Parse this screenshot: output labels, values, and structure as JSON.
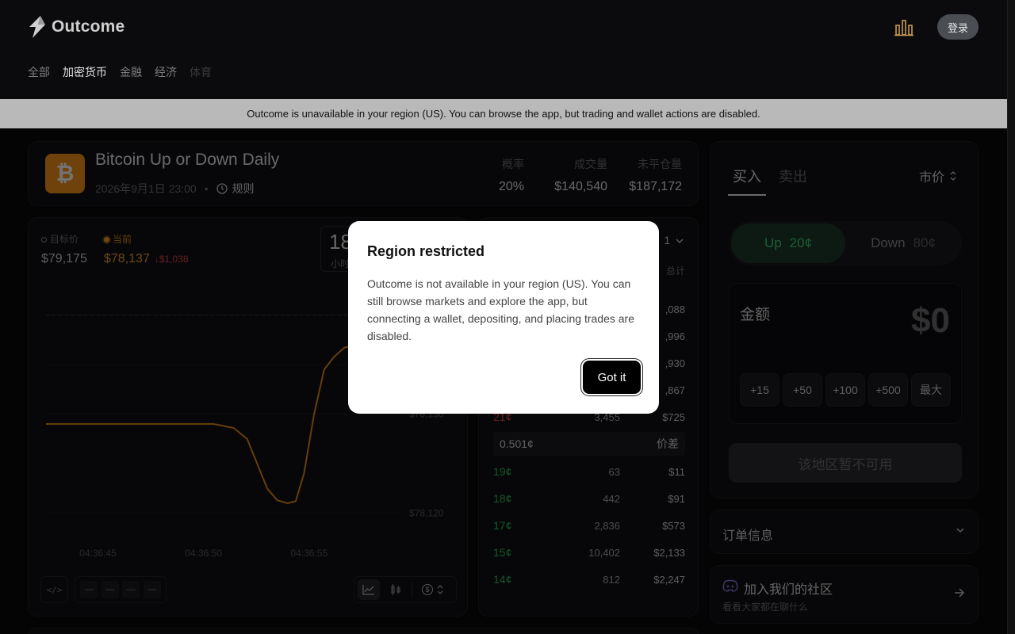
{
  "header": {
    "brand": "Outcome",
    "login_label": "登录",
    "nav": [
      "全部",
      "加密货币",
      "金融",
      "经济",
      "体育"
    ]
  },
  "banner": {
    "text": "Outcome is unavailable in your region (US). You can browse the app, but trading and wallet actions are disabled."
  },
  "market": {
    "icon_glyph": "₿",
    "title": "Bitcoin Up or Down Daily",
    "date": "2026年9月1日 23:00",
    "separator": "•",
    "rules_label": "规则",
    "stats": [
      {
        "label": "概率",
        "value": "20%"
      },
      {
        "label": "成交量",
        "value": "$140,540"
      },
      {
        "label": "未平仓量",
        "value": "$187,172"
      }
    ]
  },
  "chart": {
    "target_label": "目标价",
    "target_value": "$79,175",
    "current_label": "当前",
    "current_value": "$78,137",
    "change": "↓$1,038",
    "timer_value": "18",
    "timer_label": "小时",
    "code_label": "</>",
    "range_buttons": [
      "—",
      "—",
      "—",
      "—"
    ],
    "currency_glyph": "$"
  },
  "chart_data": {
    "type": "line",
    "x_ticks": [
      "04:36:45",
      "04:36:50",
      "04:36:55"
    ],
    "y_ticks": [
      "$78,130",
      "$78,120"
    ],
    "series": [
      {
        "points": [
          [
            0,
            78129
          ],
          [
            1,
            78129
          ],
          [
            2,
            78129
          ],
          [
            3,
            78129
          ],
          [
            4,
            78129
          ],
          [
            5,
            78129
          ],
          [
            5.6,
            78128.6
          ],
          [
            6.0,
            78127.5
          ],
          [
            6.3,
            78125
          ],
          [
            6.6,
            78122.5
          ],
          [
            6.9,
            78121.3
          ],
          [
            7.2,
            78121.0
          ],
          [
            7.45,
            78121.2
          ],
          [
            7.7,
            78124
          ],
          [
            8.0,
            78130
          ],
          [
            8.3,
            78134.5
          ],
          [
            8.6,
            78135.8
          ],
          [
            8.9,
            78136.7
          ],
          [
            9.2,
            78137
          ],
          [
            9.4,
            78137.1
          ]
        ]
      }
    ],
    "x_range": [
      0,
      10.6
    ],
    "y_range": [
      78117,
      78145
    ],
    "target_line": 78140
  },
  "orderbook": {
    "selector": "1",
    "total_label": "总计",
    "asks": [
      {
        "price": "",
        "shares": "",
        "total": ",088"
      },
      {
        "price": "",
        "shares": "",
        "total": ",996"
      },
      {
        "price": "",
        "shares": "",
        "total": ",930"
      },
      {
        "price": "",
        "shares": "",
        "total": ",867"
      },
      {
        "price": "21¢",
        "shares": "3,455",
        "total": "$725"
      }
    ],
    "spread_value": "0.501¢",
    "spread_label": "价差",
    "bids": [
      {
        "price": "19¢",
        "shares": "63",
        "total": "$11"
      },
      {
        "price": "18¢",
        "shares": "442",
        "total": "$91"
      },
      {
        "price": "17¢",
        "shares": "2,836",
        "total": "$573"
      },
      {
        "price": "15¢",
        "shares": "10,402",
        "total": "$2,133"
      },
      {
        "price": "14¢",
        "shares": "812",
        "total": "$2,247"
      }
    ]
  },
  "trade": {
    "tab_buy": "买入",
    "tab_sell": "卖出",
    "order_type": "市价",
    "up_label": "Up",
    "up_price": "20¢",
    "down_label": "Down",
    "down_price": "80¢",
    "amount_label": "金额",
    "amount_value": "$0",
    "quick": [
      "+15",
      "+50",
      "+100",
      "+500",
      "最大"
    ],
    "submit_label": "该地区暂不可用"
  },
  "order_info": {
    "label": "订单信息"
  },
  "community": {
    "title": "加入我们的社区",
    "subtitle": "看看大家都在聊什么"
  },
  "modal": {
    "title": "Region restricted",
    "body": "Outcome is not available in your region (US). You can still browse markets and explore the app, but connecting a wallet, depositing, and placing trades are disabled.",
    "button": "Got it"
  },
  "colors": {
    "accent_orange": "#f0a030",
    "up_green": "#2fbf5e",
    "down_red": "#e04545",
    "bitcoin": "#f7931a"
  }
}
